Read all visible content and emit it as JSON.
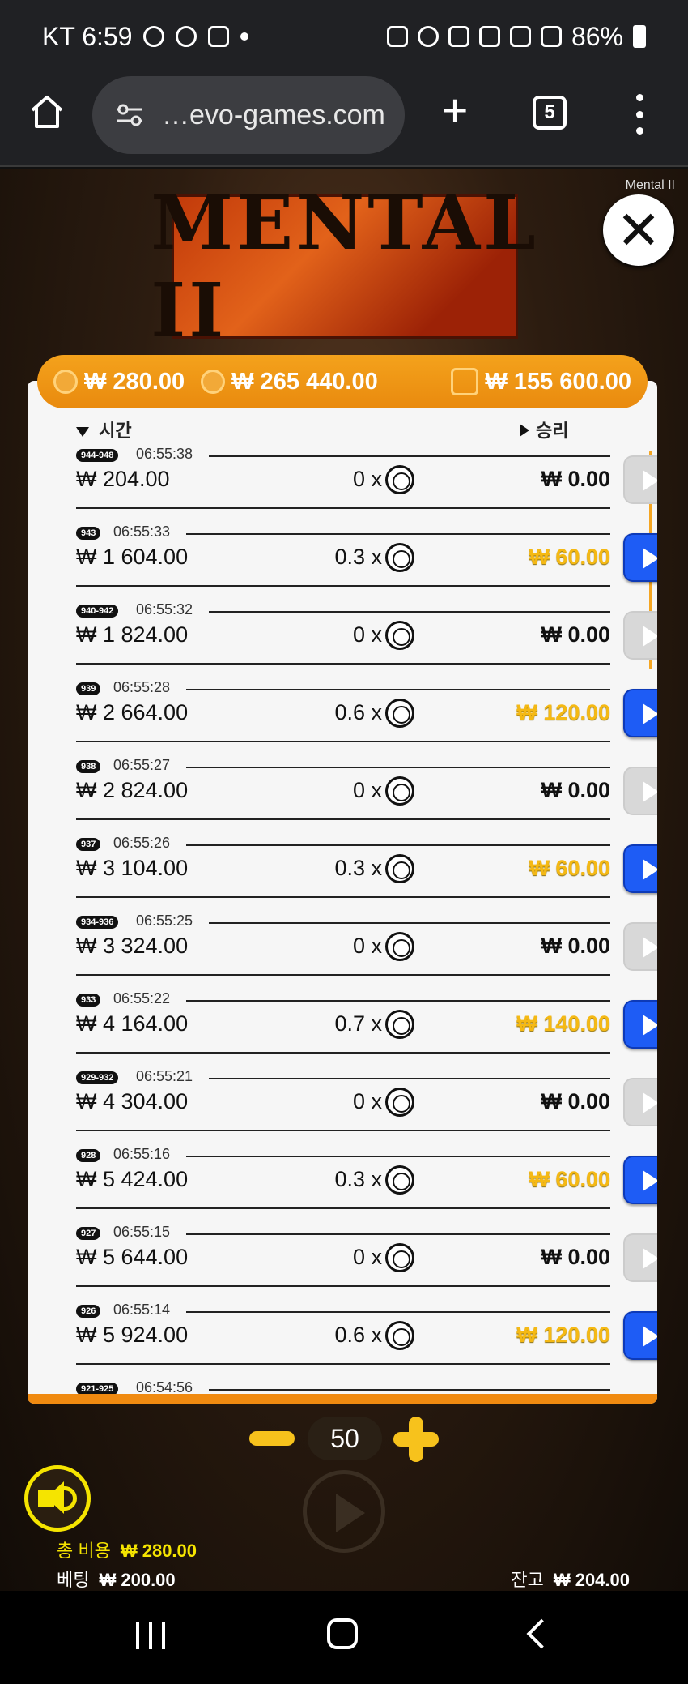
{
  "status_bar": {
    "left_text": "KT 6:59",
    "battery": "86%"
  },
  "browser": {
    "url": "…evo-games.com",
    "tab_count": "5"
  },
  "game": {
    "name": "Mental II",
    "logo_text": "MENTAL II"
  },
  "top_bar": {
    "coin1": "₩ 280.00",
    "coin2": "₩ 265 440.00",
    "wallet": "₩ 155 600.00"
  },
  "history": {
    "header_time": " 시간",
    "header_win": "승리",
    "rows": [
      {
        "tag": "944-948",
        "time": "06:55:38",
        "bet": "₩ 204.00",
        "mult": "0 x",
        "win": "₩ 0.00",
        "gold": false
      },
      {
        "tag": "943",
        "time": "06:55:33",
        "bet": "₩ 1 604.00",
        "mult": "0.3 x",
        "win": "₩ 60.00",
        "gold": true
      },
      {
        "tag": "940-942",
        "time": "06:55:32",
        "bet": "₩ 1 824.00",
        "mult": "0 x",
        "win": "₩ 0.00",
        "gold": false
      },
      {
        "tag": "939",
        "time": "06:55:28",
        "bet": "₩ 2 664.00",
        "mult": "0.6 x",
        "win": "₩ 120.00",
        "gold": true
      },
      {
        "tag": "938",
        "time": "06:55:27",
        "bet": "₩ 2 824.00",
        "mult": "0 x",
        "win": "₩ 0.00",
        "gold": false
      },
      {
        "tag": "937",
        "time": "06:55:26",
        "bet": "₩ 3 104.00",
        "mult": "0.3 x",
        "win": "₩ 60.00",
        "gold": true
      },
      {
        "tag": "934-936",
        "time": "06:55:25",
        "bet": "₩ 3 324.00",
        "mult": "0 x",
        "win": "₩ 0.00",
        "gold": false
      },
      {
        "tag": "933",
        "time": "06:55:22",
        "bet": "₩ 4 164.00",
        "mult": "0.7 x",
        "win": "₩ 140.00",
        "gold": true
      },
      {
        "tag": "929-932",
        "time": "06:55:21",
        "bet": "₩ 4 304.00",
        "mult": "0 x",
        "win": "₩ 0.00",
        "gold": false
      },
      {
        "tag": "928",
        "time": "06:55:16",
        "bet": "₩ 5 424.00",
        "mult": "0.3 x",
        "win": "₩ 60.00",
        "gold": true
      },
      {
        "tag": "927",
        "time": "06:55:15",
        "bet": "₩ 5 644.00",
        "mult": "0 x",
        "win": "₩ 0.00",
        "gold": false
      },
      {
        "tag": "926",
        "time": "06:55:14",
        "bet": "₩ 5 924.00",
        "mult": "0.6 x",
        "win": "₩ 120.00",
        "gold": true
      },
      {
        "tag": "921-925",
        "time": "06:54:56",
        "bet": "",
        "mult": "",
        "win": "",
        "gold": false,
        "partial": true
      }
    ]
  },
  "controls": {
    "stake": "50",
    "total_cost_label": "총 비용",
    "total_cost": "₩ 280.00",
    "bet_label": "베팅",
    "bet": "₩ 200.00",
    "balance_label": "잔고",
    "balance": "₩ 204.00"
  },
  "colors": {
    "accent_orange": "#f08a10",
    "win_gold": "#f5b914",
    "replay_blue": "#1e5cf5"
  }
}
